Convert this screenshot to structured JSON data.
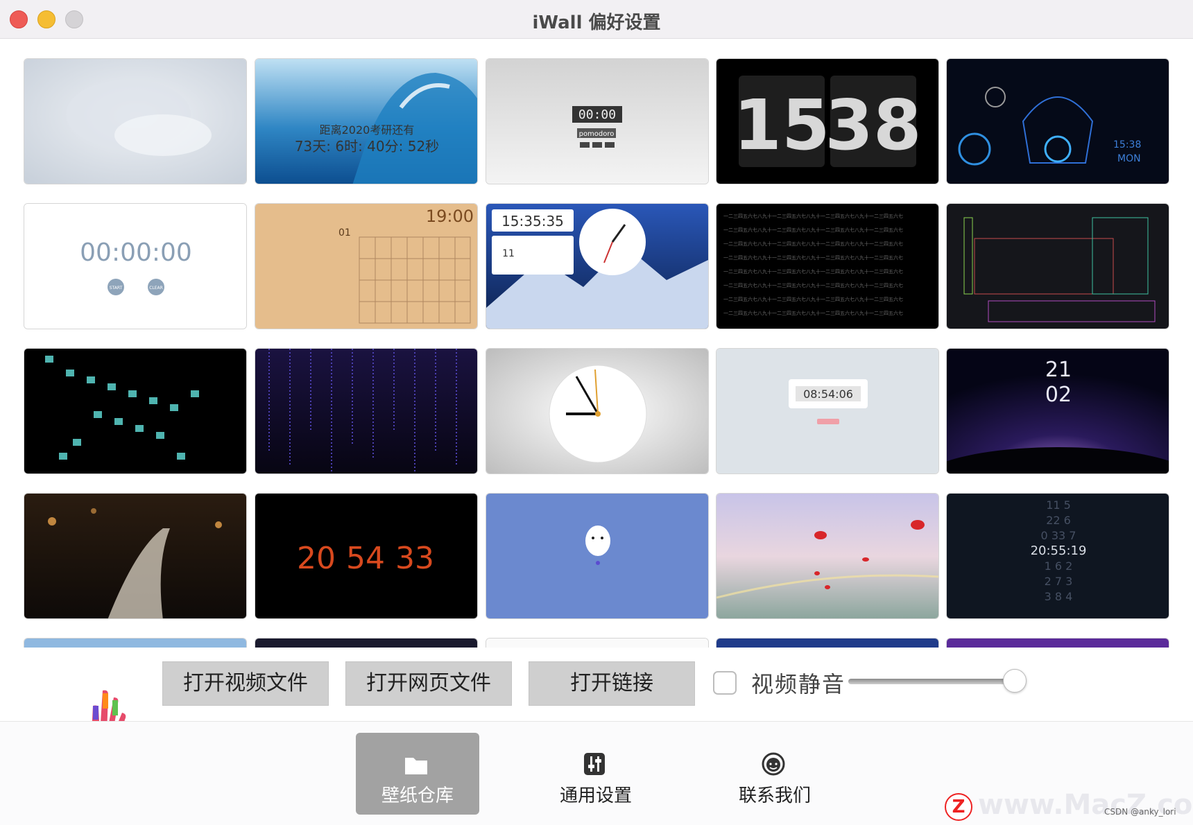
{
  "window": {
    "title": "iWall 偏好设置"
  },
  "thumbnails": {
    "t2": {
      "line1": "距离2020考研还有",
      "line2": "73天: 6时: 40分: 52秒"
    },
    "t3": {
      "clock": "00:00",
      "label": "pomodoro"
    },
    "t4": {
      "hours": "15",
      "minutes": "38"
    },
    "t5": {
      "time": "15:38",
      "day": "MON"
    },
    "t6": {
      "time": "00:00:00",
      "btn1": "START",
      "btn2": "CLEAR"
    },
    "t7": {
      "time": "19:00",
      "day": "01"
    },
    "t8": {
      "time": "15:35:35",
      "day": "11"
    },
    "t14": {
      "time": "08:54:06"
    },
    "t15": {
      "hour": "21",
      "minute": "02"
    },
    "t17": {
      "h": "20",
      "m": "54",
      "s": "33"
    },
    "t20": {
      "center": "20:55:19"
    }
  },
  "controls": {
    "open_video": "打开视频文件",
    "open_web": "打开网页文件",
    "open_link": "打开链接",
    "mute_label": "视频静音",
    "mute_checked": false,
    "volume": 0.93
  },
  "tabs": [
    {
      "label": "壁纸仓库",
      "icon": "folder-icon",
      "active": true
    },
    {
      "label": "通用设置",
      "icon": "sliders-icon",
      "active": false
    },
    {
      "label": "联系我们",
      "icon": "support-agent-icon",
      "active": false
    }
  ],
  "watermark": {
    "badge": "Z",
    "text": "www.MacZ.com",
    "credit": "CSDN @anky_lori"
  }
}
